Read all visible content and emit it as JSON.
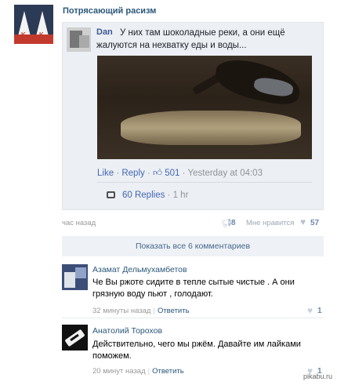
{
  "group": {
    "title": "Потрясающий расизм",
    "avatar_letters": [
      "K",
      "K"
    ]
  },
  "embedded_comment": {
    "author": "Dan",
    "text": "У них там шоколадные реки, а они ещё жалуются на нехватку еды и воды...",
    "actions": {
      "like": "Like",
      "separator": "·",
      "reply": "Reply",
      "reactions_count": "501",
      "timestamp": "Yesterday at 04:03"
    },
    "replies": {
      "label": "60 Replies",
      "time": "1 hr"
    }
  },
  "post_meta": {
    "time": "час назад",
    "shares": "8",
    "like_label": "Мне нравится",
    "likes": "57"
  },
  "show_all_comments": "Показать все 6 комментариев",
  "comments": [
    {
      "author": "Азамат Дельмухамбетов",
      "text": "Че Вы ржоте сидите в тепле сытые чистые . А они грязную воду пьют , голодают.",
      "time": "32 минуты назад",
      "reply_label": "Ответить",
      "likes": "1"
    },
    {
      "author": "Анатолий Торохов",
      "text": "Действительно, чего мы ржём. Давайте им лайками поможем.",
      "time": "20 минут назад",
      "reply_label": "Ответить",
      "likes": "1"
    }
  ],
  "watermark": "pikabu.ru",
  "colors": {
    "link_blue": "#2b587a",
    "fb_blue": "#4267b2",
    "card_bg": "#eceff3"
  }
}
